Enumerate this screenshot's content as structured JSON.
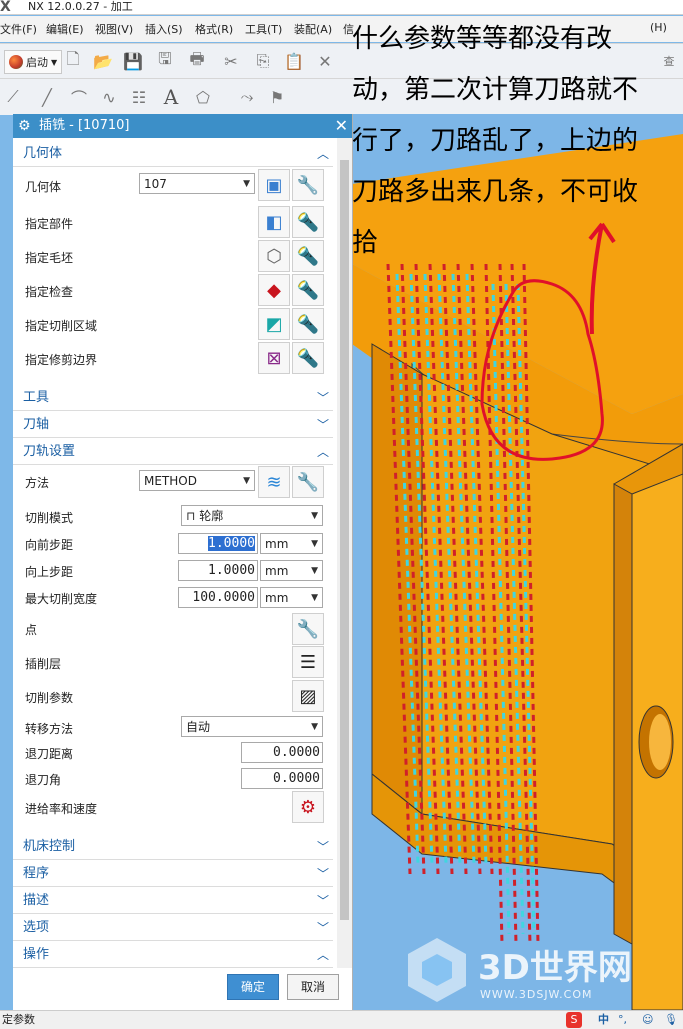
{
  "window": {
    "title": "NX 12.0.0.27 - 加工"
  },
  "menu": {
    "items": [
      "文件(F)",
      "编辑(E)",
      "视图(V)",
      "插入(S)",
      "格式(R)",
      "工具(T)",
      "装配(A)",
      "信",
      "(H)"
    ]
  },
  "toolbar": {
    "start_label": "启动",
    "right_partial": "查"
  },
  "annotation": {
    "lines": [
      "什么参数等等都没有改",
      "动，第二次计算刀路就不",
      "行了，刀路乱了，上边的",
      "刀路多出来几条，不可收",
      "拾"
    ]
  },
  "dialog": {
    "title": "插铣 - [10710]",
    "sections": {
      "geometry": {
        "title": "几何体",
        "geometry_label": "几何体",
        "geometry_value": "107",
        "rows": [
          "指定部件",
          "指定毛坯",
          "指定检查",
          "指定切削区域",
          "指定修剪边界"
        ]
      },
      "tool": {
        "title": "工具"
      },
      "axis": {
        "title": "刀轴"
      },
      "path": {
        "title": "刀轨设置",
        "method_label": "方法",
        "method_value": "METHOD",
        "cut_mode_label": "切削模式",
        "cut_mode_value": "轮廓",
        "stepover_label": "向前步距",
        "stepover_value": "1.0000",
        "stepup_label": "向上步距",
        "stepup_value": "1.0000",
        "maxwidth_label": "最大切削宽度",
        "maxwidth_value": "100.0000",
        "unit": "mm",
        "point_label": "点",
        "layer_label": "插削层",
        "params_label": "切削参数",
        "transfer_label": "转移方法",
        "transfer_value": "自动",
        "retract_dist_label": "退刀距离",
        "retract_dist_value": "0.0000",
        "retract_angle_label": "退刀角",
        "retract_angle_value": "0.0000",
        "feeds_label": "进给率和速度"
      },
      "machine": {
        "title": "机床控制"
      },
      "program": {
        "title": "程序"
      },
      "desc": {
        "title": "描述"
      },
      "options": {
        "title": "选项"
      },
      "actions": {
        "title": "操作"
      }
    },
    "ok_label": "确定",
    "cancel_label": "取消"
  },
  "status": {
    "text": "定参数"
  },
  "watermark": {
    "brand": "3D世界网",
    "url": "WWW.3DSJW.COM"
  },
  "tray": {
    "ime": "中"
  },
  "colors": {
    "dialog_title": "#3c8fc8",
    "section_head": "#1b5fa3",
    "part": "#f5a623",
    "toolpath": "#d0202a",
    "annot_circle": "#e0102a"
  }
}
